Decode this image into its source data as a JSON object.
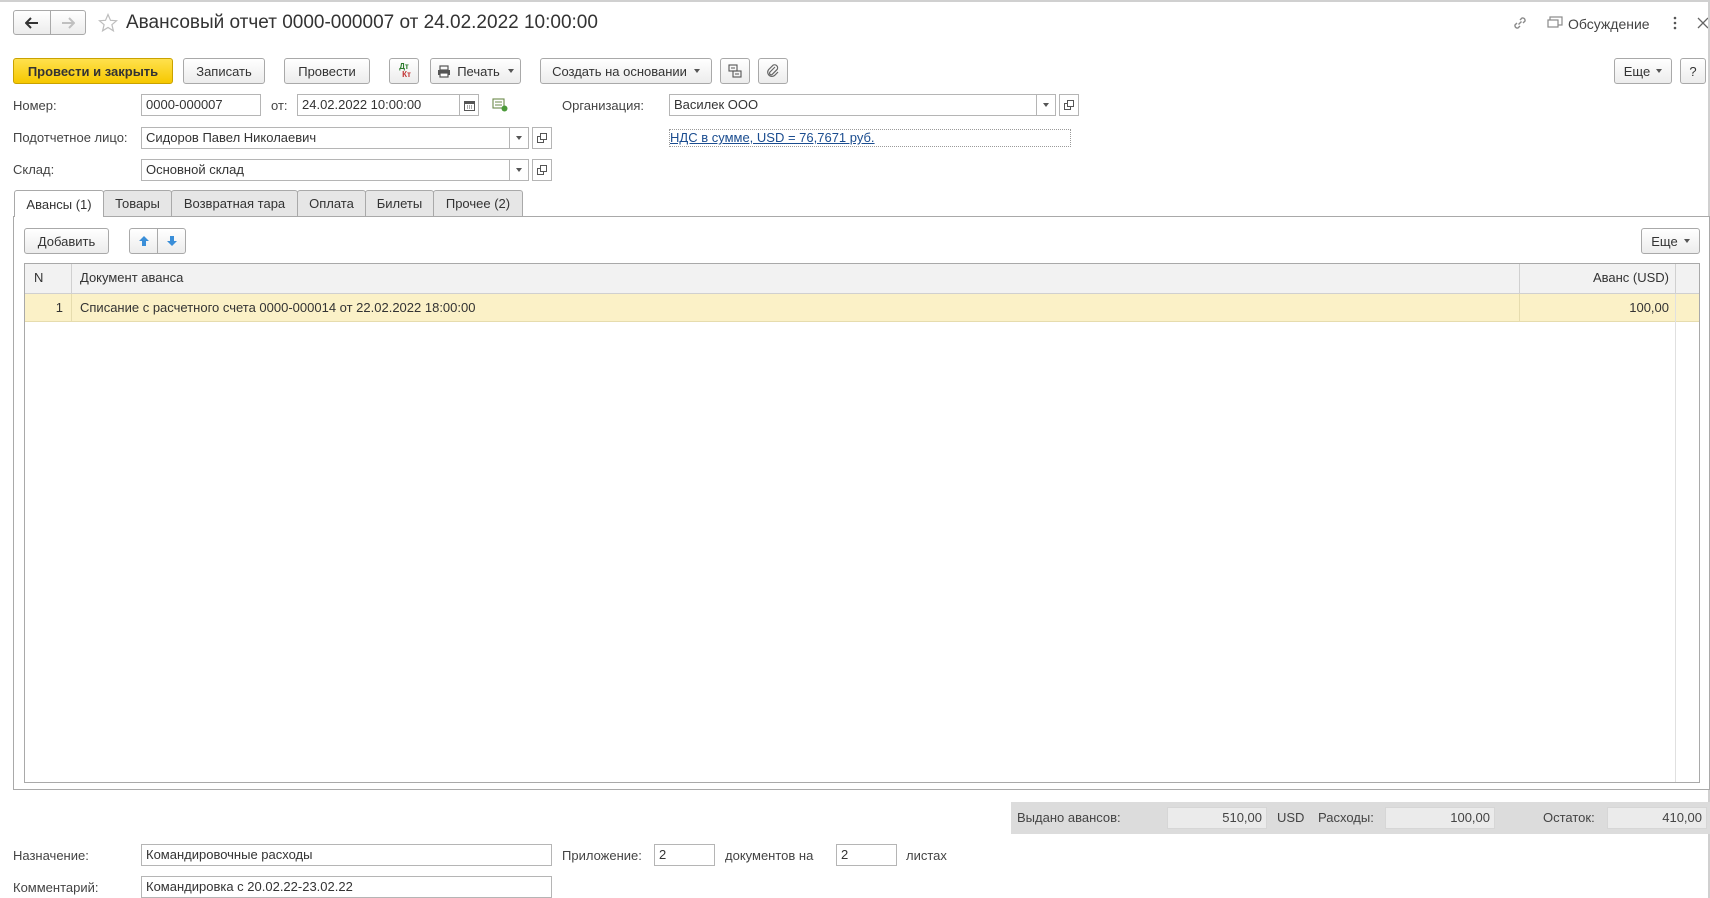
{
  "window": {
    "title": "Авансовый отчет 0000-000007 от 24.02.2022 10:00:00",
    "discussion_label": "Обсуждение"
  },
  "toolbar": {
    "post_close": "Провести и закрыть",
    "save": "Записать",
    "post": "Провести",
    "dtkt_top": "Дт",
    "dtkt_bottom": "Кт",
    "print": "Печать",
    "create_based": "Создать на основании",
    "more": "Еще",
    "help": "?"
  },
  "form": {
    "number_label": "Номер:",
    "number_value": "0000-000007",
    "from_label": "от:",
    "date_value": "24.02.2022 10:00:00",
    "org_label": "Организация:",
    "org_value": "Василек ООО",
    "person_label": "Подотчетное лицо:",
    "person_value": "Сидоров Павел Николаевич",
    "vat_link": "НДС в сумме, USD = 76,7671 руб.",
    "warehouse_label": "Склад:",
    "warehouse_value": "Основной склад"
  },
  "tabs": [
    {
      "label": "Авансы (1)",
      "active": true
    },
    {
      "label": "Товары"
    },
    {
      "label": "Возвратная тара"
    },
    {
      "label": "Оплата"
    },
    {
      "label": "Билеты"
    },
    {
      "label": "Прочее (2)"
    }
  ],
  "table": {
    "add_label": "Добавить",
    "more_label": "Еще",
    "columns": [
      "N",
      "Документ аванса",
      "Аванс (USD)"
    ],
    "rows": [
      {
        "n": "1",
        "doc": "Списание с расчетного счета 0000-000014 от 22.02.2022 18:00:00",
        "amount": "100,00"
      }
    ]
  },
  "totals": {
    "issued_label": "Выдано авансов:",
    "issued_value": "510,00",
    "currency": "USD",
    "expenses_label": "Расходы:",
    "expenses_value": "100,00",
    "balance_label": "Остаток:",
    "balance_value": "410,00"
  },
  "footer": {
    "purpose_label": "Назначение:",
    "purpose_value": "Командировочные расходы",
    "attachment_label": "Приложение:",
    "attachment_docs": "2",
    "docs_on_label": "документов на",
    "attachment_sheets": "2",
    "sheets_label": "листах",
    "comment_label": "Комментарий:",
    "comment_value": "Командировка с 20.02.22-23.02.22"
  },
  "colors": {
    "primary_button": "#f6c800",
    "selected_row": "#fbf1c7",
    "link": "#1a4c8f"
  }
}
